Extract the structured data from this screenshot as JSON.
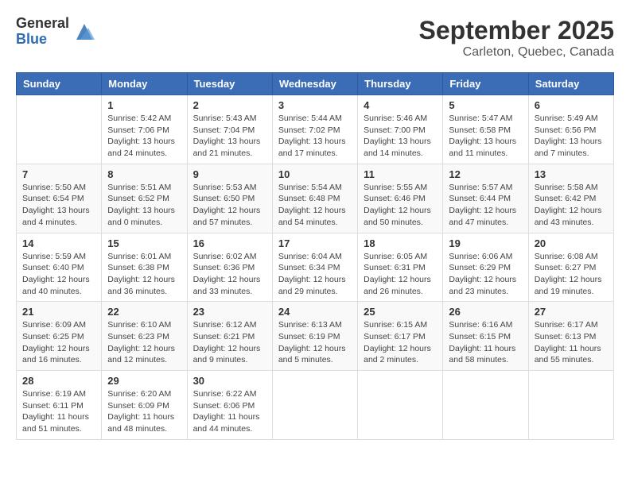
{
  "header": {
    "logo_general": "General",
    "logo_blue": "Blue",
    "month_title": "September 2025",
    "location": "Carleton, Quebec, Canada"
  },
  "days_of_week": [
    "Sunday",
    "Monday",
    "Tuesday",
    "Wednesday",
    "Thursday",
    "Friday",
    "Saturday"
  ],
  "weeks": [
    [
      {
        "day": "",
        "info": ""
      },
      {
        "day": "1",
        "info": "Sunrise: 5:42 AM\nSunset: 7:06 PM\nDaylight: 13 hours and 24 minutes."
      },
      {
        "day": "2",
        "info": "Sunrise: 5:43 AM\nSunset: 7:04 PM\nDaylight: 13 hours and 21 minutes."
      },
      {
        "day": "3",
        "info": "Sunrise: 5:44 AM\nSunset: 7:02 PM\nDaylight: 13 hours and 17 minutes."
      },
      {
        "day": "4",
        "info": "Sunrise: 5:46 AM\nSunset: 7:00 PM\nDaylight: 13 hours and 14 minutes."
      },
      {
        "day": "5",
        "info": "Sunrise: 5:47 AM\nSunset: 6:58 PM\nDaylight: 13 hours and 11 minutes."
      },
      {
        "day": "6",
        "info": "Sunrise: 5:49 AM\nSunset: 6:56 PM\nDaylight: 13 hours and 7 minutes."
      }
    ],
    [
      {
        "day": "7",
        "info": "Sunrise: 5:50 AM\nSunset: 6:54 PM\nDaylight: 13 hours and 4 minutes."
      },
      {
        "day": "8",
        "info": "Sunrise: 5:51 AM\nSunset: 6:52 PM\nDaylight: 13 hours and 0 minutes."
      },
      {
        "day": "9",
        "info": "Sunrise: 5:53 AM\nSunset: 6:50 PM\nDaylight: 12 hours and 57 minutes."
      },
      {
        "day": "10",
        "info": "Sunrise: 5:54 AM\nSunset: 6:48 PM\nDaylight: 12 hours and 54 minutes."
      },
      {
        "day": "11",
        "info": "Sunrise: 5:55 AM\nSunset: 6:46 PM\nDaylight: 12 hours and 50 minutes."
      },
      {
        "day": "12",
        "info": "Sunrise: 5:57 AM\nSunset: 6:44 PM\nDaylight: 12 hours and 47 minutes."
      },
      {
        "day": "13",
        "info": "Sunrise: 5:58 AM\nSunset: 6:42 PM\nDaylight: 12 hours and 43 minutes."
      }
    ],
    [
      {
        "day": "14",
        "info": "Sunrise: 5:59 AM\nSunset: 6:40 PM\nDaylight: 12 hours and 40 minutes."
      },
      {
        "day": "15",
        "info": "Sunrise: 6:01 AM\nSunset: 6:38 PM\nDaylight: 12 hours and 36 minutes."
      },
      {
        "day": "16",
        "info": "Sunrise: 6:02 AM\nSunset: 6:36 PM\nDaylight: 12 hours and 33 minutes."
      },
      {
        "day": "17",
        "info": "Sunrise: 6:04 AM\nSunset: 6:34 PM\nDaylight: 12 hours and 29 minutes."
      },
      {
        "day": "18",
        "info": "Sunrise: 6:05 AM\nSunset: 6:31 PM\nDaylight: 12 hours and 26 minutes."
      },
      {
        "day": "19",
        "info": "Sunrise: 6:06 AM\nSunset: 6:29 PM\nDaylight: 12 hours and 23 minutes."
      },
      {
        "day": "20",
        "info": "Sunrise: 6:08 AM\nSunset: 6:27 PM\nDaylight: 12 hours and 19 minutes."
      }
    ],
    [
      {
        "day": "21",
        "info": "Sunrise: 6:09 AM\nSunset: 6:25 PM\nDaylight: 12 hours and 16 minutes."
      },
      {
        "day": "22",
        "info": "Sunrise: 6:10 AM\nSunset: 6:23 PM\nDaylight: 12 hours and 12 minutes."
      },
      {
        "day": "23",
        "info": "Sunrise: 6:12 AM\nSunset: 6:21 PM\nDaylight: 12 hours and 9 minutes."
      },
      {
        "day": "24",
        "info": "Sunrise: 6:13 AM\nSunset: 6:19 PM\nDaylight: 12 hours and 5 minutes."
      },
      {
        "day": "25",
        "info": "Sunrise: 6:15 AM\nSunset: 6:17 PM\nDaylight: 12 hours and 2 minutes."
      },
      {
        "day": "26",
        "info": "Sunrise: 6:16 AM\nSunset: 6:15 PM\nDaylight: 11 hours and 58 minutes."
      },
      {
        "day": "27",
        "info": "Sunrise: 6:17 AM\nSunset: 6:13 PM\nDaylight: 11 hours and 55 minutes."
      }
    ],
    [
      {
        "day": "28",
        "info": "Sunrise: 6:19 AM\nSunset: 6:11 PM\nDaylight: 11 hours and 51 minutes."
      },
      {
        "day": "29",
        "info": "Sunrise: 6:20 AM\nSunset: 6:09 PM\nDaylight: 11 hours and 48 minutes."
      },
      {
        "day": "30",
        "info": "Sunrise: 6:22 AM\nSunset: 6:06 PM\nDaylight: 11 hours and 44 minutes."
      },
      {
        "day": "",
        "info": ""
      },
      {
        "day": "",
        "info": ""
      },
      {
        "day": "",
        "info": ""
      },
      {
        "day": "",
        "info": ""
      }
    ]
  ]
}
